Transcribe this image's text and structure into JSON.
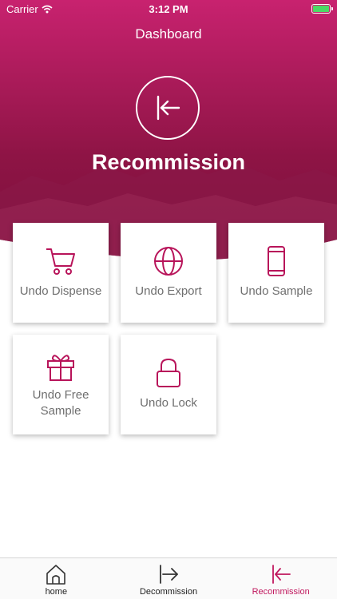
{
  "status_bar": {
    "carrier": "Carrier",
    "time": "3:12 PM"
  },
  "header": {
    "nav_title": "Dashboard",
    "hero_icon": "arrow-left-to-bar-icon",
    "title": "Recommission",
    "gradient_top": "#c51f6d",
    "gradient_bottom": "#7e0f3c"
  },
  "tiles": [
    {
      "label": "Undo Dispense",
      "icon": "shopping-cart-icon"
    },
    {
      "label": "Undo Export",
      "icon": "globe-icon"
    },
    {
      "label": "Undo Sample",
      "icon": "smartphone-icon"
    },
    {
      "label": "Undo Free Sample",
      "icon": "gift-icon"
    },
    {
      "label": "Undo Lock",
      "icon": "lock-icon"
    }
  ],
  "tabbar": {
    "items": [
      {
        "label": "home",
        "icon": "home-icon",
        "active": false
      },
      {
        "label": "Decommission",
        "icon": "arrow-right-to-bar-icon",
        "active": false
      },
      {
        "label": "Recommission",
        "icon": "arrow-left-to-bar-icon",
        "active": true
      }
    ]
  },
  "colors": {
    "accent": "#c0185e",
    "icon_stroke": "#b8145a",
    "label_gray": "#6f6f6f"
  }
}
